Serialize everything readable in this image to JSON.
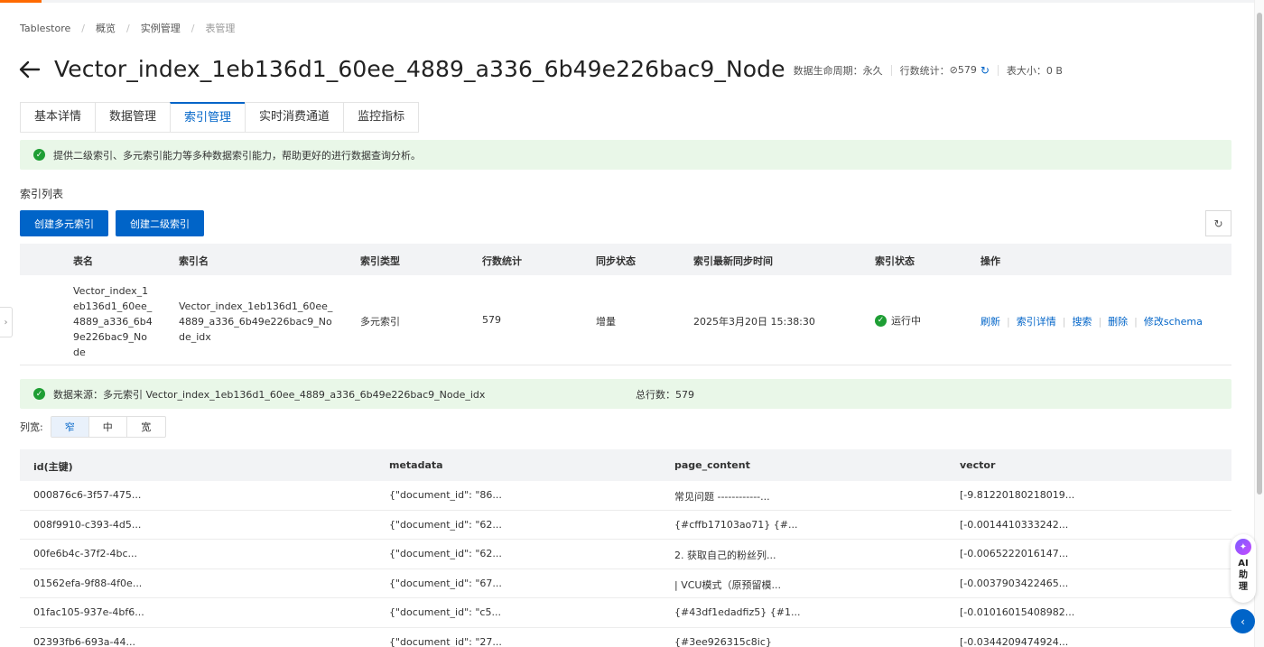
{
  "breadcrumb": [
    "Tablestore",
    "概览",
    "实例管理",
    "表管理"
  ],
  "header": {
    "title": "Vector_index_1eb136d1_60ee_4889_a336_6b49e226bac9_Node",
    "lifecycle": "数据生命周期：永久",
    "row_stats_label": "行数统计：",
    "row_stats_value": "⊘579",
    "table_size": "表大小：0 B"
  },
  "tabs": [
    {
      "label": "基本详情",
      "active": false
    },
    {
      "label": "数据管理",
      "active": false
    },
    {
      "label": "索引管理",
      "active": true
    },
    {
      "label": "实时消费通道",
      "active": false
    },
    {
      "label": "监控指标",
      "active": false
    }
  ],
  "notice_top": "提供二级索引、多元索引能力等多种数据索引能力，帮助更好的进行数据查询分析。",
  "section_title": "索引列表",
  "buttons": {
    "create_search_index": "创建多元索引",
    "create_secondary_index": "创建二级索引"
  },
  "index_table": {
    "headers": [
      "表名",
      "索引名",
      "索引类型",
      "行数统计",
      "同步状态",
      "索引最新同步时间",
      "索引状态",
      "操作"
    ],
    "row": {
      "table_name": "Vector_index_1eb136d1_60ee_4889_a336_6b49e226bac9_Node",
      "index_name": "Vector_index_1eb136d1_60ee_4889_a336_6b49e226bac9_Node_idx",
      "index_type": "多元索引",
      "row_count": "579",
      "sync_state": "增量",
      "last_sync": "2025年3月20日 15:38:30",
      "status": "运行中",
      "ops": [
        "刷新",
        "索引详情",
        "搜索",
        "删除",
        "修改schema"
      ]
    }
  },
  "data_source": {
    "label": "数据来源：多元索引 Vector_index_1eb136d1_60ee_4889_a336_6b49e226bac9_Node_idx",
    "total": "总行数：579"
  },
  "col_width": {
    "label": "列宽:",
    "options": [
      "窄",
      "中",
      "宽"
    ],
    "selected": "窄"
  },
  "data_table": {
    "headers": [
      "id(主键)",
      "metadata",
      "page_content",
      "vector"
    ],
    "rows": [
      [
        "000876c6-3f57-475...",
        "{\"document_id\": \"86...",
        "常见问题 ------------...",
        "[-9.81220180218019..."
      ],
      [
        "008f9910-c393-4d5...",
        "{\"document_id\": \"62...",
        "{#cffb17103ao71} {#...",
        "[-0.0014410333242..."
      ],
      [
        "00fe6b4c-37f2-4bc...",
        "{\"document_id\": \"62...",
        "2. 获取自己的粉丝列...",
        "[-0.0065222016147..."
      ],
      [
        "01562efa-9f88-4f0e...",
        "{\"document_id\": \"67...",
        "| VCU模式（原预留模...",
        "[-0.0037903422465..."
      ],
      [
        "01fac105-937e-4bf6...",
        "{\"document_id\": \"c5...",
        "{#43df1edadfiz5} {#1...",
        "[-0.01016015408982..."
      ],
      [
        "02393fb6-693a-44...",
        "{\"document_id\": \"27...",
        "{#3ee926315c8ic}",
        "[-0.0344209474924..."
      ]
    ]
  },
  "ai_helper": "AI助理",
  "colors": {
    "primary": "#0064c8",
    "success": "#1e9e34",
    "notice_bg": "#e9f7e8",
    "brand": "#ff6a00"
  }
}
